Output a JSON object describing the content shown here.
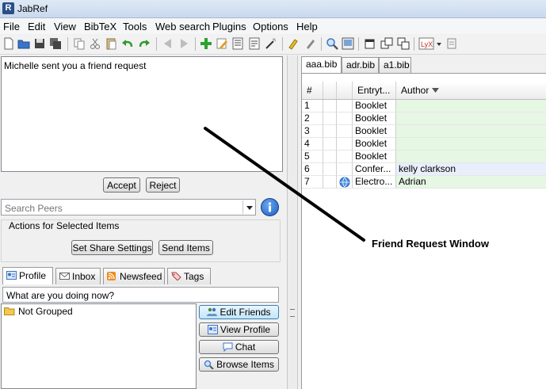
{
  "window": {
    "title": "JabRef",
    "app_icon_text": "R"
  },
  "menu": [
    "File",
    "Edit",
    "View",
    "BibTeX",
    "Tools",
    "Web search",
    "Plugins",
    "Options",
    "Help"
  ],
  "request": {
    "message": "Michelle sent you a friend request",
    "accept": "Accept",
    "reject": "Reject"
  },
  "search": {
    "placeholder": "Search Peers"
  },
  "actions": {
    "title": "Actions for Selected Items",
    "share_settings": "Set Share Settings",
    "send_items": "Send Items"
  },
  "tabs": [
    "Profile",
    "Inbox",
    "Newsfeed",
    "Tags"
  ],
  "status": {
    "value": "What are you doing now?"
  },
  "friends": {
    "group": "Not Grouped"
  },
  "side_buttons": [
    "Edit Friends",
    "View Profile",
    "Chat",
    "Browse Items"
  ],
  "file_tabs": [
    "aaa.bib",
    "adr.bib",
    "a1.bib"
  ],
  "table": {
    "headers": {
      "num": "#",
      "entrytype": "Entryt...",
      "author": "Author"
    },
    "rows": [
      {
        "num": "1",
        "type": "Booklet",
        "author": ""
      },
      {
        "num": "2",
        "type": "Booklet",
        "author": ""
      },
      {
        "num": "3",
        "type": "Booklet",
        "author": ""
      },
      {
        "num": "4",
        "type": "Booklet",
        "author": ""
      },
      {
        "num": "5",
        "type": "Booklet",
        "author": ""
      },
      {
        "num": "6",
        "type": "Confer...",
        "author": "kelly clarkson"
      },
      {
        "num": "7",
        "type": "Electro...",
        "author": "Adrian"
      }
    ]
  },
  "annotation": {
    "label": "Friend Request Window"
  },
  "colors": {
    "row_green": "#e6f7e4",
    "row_blue": "#e8eefa",
    "accent": "#1d5fc0"
  }
}
